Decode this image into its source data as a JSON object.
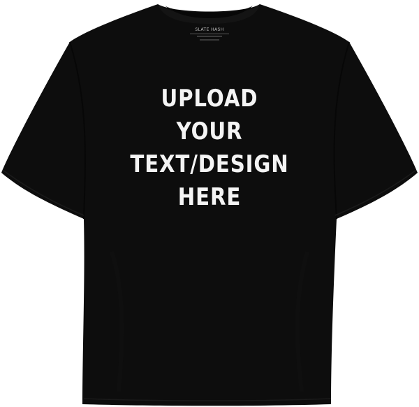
{
  "product": {
    "brand_label": "SLATE HASH",
    "print_lines": [
      "UPLOAD",
      "YOUR",
      "TEXT/DESIGN",
      "HERE"
    ],
    "shirt_color": "#0d0d0d",
    "shirt_shadow": "#080808",
    "background": "#ffffff",
    "print_color": "#f4f4f4"
  }
}
